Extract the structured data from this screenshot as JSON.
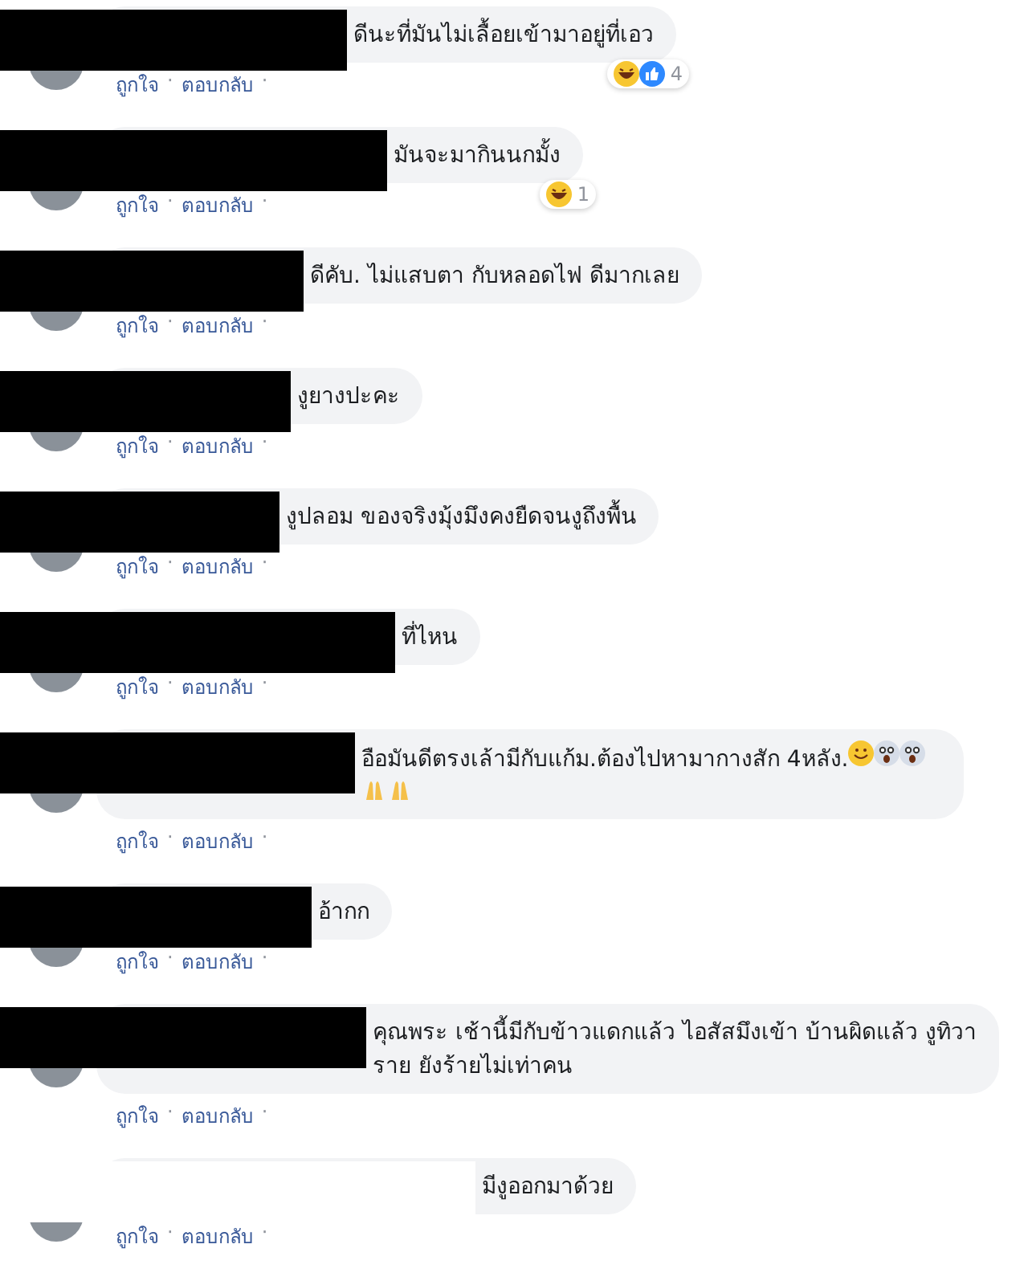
{
  "comments": [
    {
      "text": "ดีนะที่มันไม่เลื้อยเข้ามาอยู่ที่เอว",
      "redaction": {
        "color": "#000000"
      },
      "reactions": {
        "icons": [
          {
            "kind": "haha"
          },
          {
            "kind": "like"
          }
        ],
        "count": "4"
      },
      "actions": [
        "ถูกใจ",
        "ตอบกลับ"
      ],
      "separator": "·"
    },
    {
      "text": "มันจะมากินนกมั้ง",
      "redaction": {
        "color": "#000000"
      },
      "reactions": {
        "icons": [
          {
            "kind": "haha"
          }
        ],
        "count": "1"
      },
      "actions": [
        "ถูกใจ",
        "ตอบกลับ"
      ],
      "separator": "·"
    },
    {
      "text": "ดีคับ. ไม่แสบตา กับหลอดไฟ ดีมากเลย",
      "redaction": {
        "color": "#000000"
      },
      "actions": [
        "ถูกใจ",
        "ตอบกลับ"
      ],
      "separator": "·"
    },
    {
      "text": "งูยางปะคะ",
      "redaction": {
        "color": "#000000"
      },
      "actions": [
        "ถูกใจ",
        "ตอบกลับ"
      ],
      "separator": "·"
    },
    {
      "text": "งูปลอม ของจริงมุ้งมึงคงยืดจนงูถึงพื้น",
      "redaction": {
        "color": "#000000"
      },
      "actions": [
        "ถูกใจ",
        "ตอบกลับ"
      ],
      "separator": "·"
    },
    {
      "text": "ที่ไหน",
      "redaction": {
        "color": "#000000"
      },
      "actions": [
        "ถูกใจ",
        "ตอบกลับ"
      ],
      "separator": "·"
    },
    {
      "text": "อือมันดีตรงเล้ามีกับแก้ม.ต้องไปหามากางสัก 4หลัง.",
      "emoji": [
        {
          "kind": "smile"
        },
        {
          "kind": "scream"
        },
        {
          "kind": "scream"
        },
        {
          "kind": "pray"
        },
        {
          "kind": "pray"
        }
      ],
      "redaction": {
        "color": "#000000"
      },
      "actions": [
        "ถูกใจ",
        "ตอบกลับ"
      ],
      "separator": "·"
    },
    {
      "text": "อ้ากก",
      "redaction": {
        "color": "#000000"
      },
      "actions": [
        "ถูกใจ",
        "ตอบกลับ"
      ],
      "separator": "·"
    },
    {
      "text": "คุณพระ เช้านี้มีกับข้าวแดกแล้ว ไอสัสมึงเข้า บ้านผิดแล้ว งูทิวาราย ยังร้ายไม่เท่าคน",
      "redaction": {
        "color": "#000000"
      },
      "actions": [
        "ถูกใจ",
        "ตอบกลับ"
      ],
      "separator": "·"
    },
    {
      "text": "มีงูออกมาด้วย",
      "redaction": {
        "color": "#ffffff"
      },
      "actions": [
        "ถูกใจ",
        "ตอบกลับ"
      ],
      "separator": "·"
    }
  ]
}
